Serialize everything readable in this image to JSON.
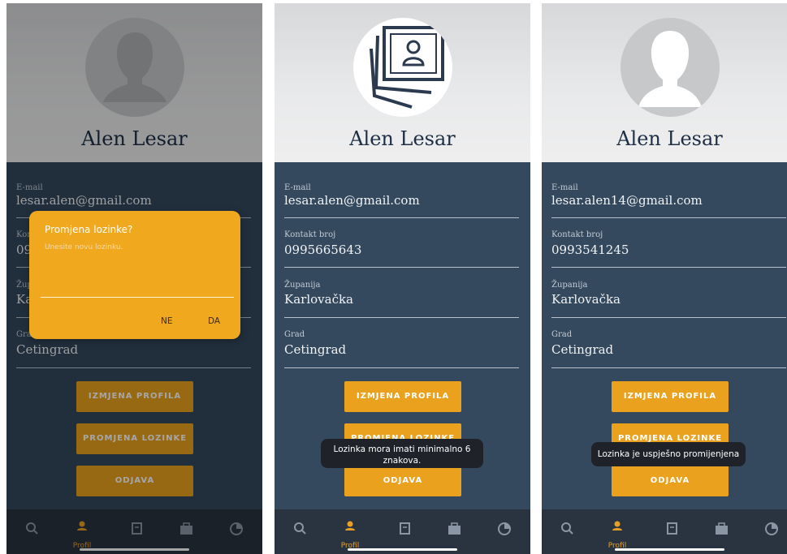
{
  "colors": {
    "accent": "#eaa21e",
    "background": "#34495e",
    "navbar": "#2a3440"
  },
  "screens": [
    {
      "name": "Alen Lesar",
      "fields": [
        {
          "label": "E-mail",
          "value": "lesar.alen@gmail.com"
        },
        {
          "label": "Kontakt broj",
          "value": "0995665643"
        },
        {
          "label": "Županija",
          "value": "Karlovačka"
        },
        {
          "label": "Grad",
          "value": "Cetingrad"
        }
      ],
      "buttons": {
        "edit": "IZMJENA PROFILA",
        "password": "PROMJENA LOZINKE",
        "logout": "ODJAVA"
      },
      "dialog": {
        "title": "Promjena lozinke?",
        "hint": "Unesite novu lozinku.",
        "no": "NE",
        "yes": "DA"
      },
      "nav": {
        "active_label": "Profil"
      }
    },
    {
      "name": "Alen Lesar",
      "fields": [
        {
          "label": "E-mail",
          "value": "lesar.alen@gmail.com"
        },
        {
          "label": "Kontakt broj",
          "value": "0995665643"
        },
        {
          "label": "Županija",
          "value": "Karlovačka"
        },
        {
          "label": "Grad",
          "value": "Cetingrad"
        }
      ],
      "buttons": {
        "edit": "IZMJENA PROFILA",
        "password": "PROMJENA LOZINKE",
        "logout": "ODJAVA"
      },
      "toast_line1": "Lozinka mora imati minimalno 6",
      "toast_line2": "znakova.",
      "nav": {
        "active_label": "Profil"
      }
    },
    {
      "name": "Alen Lesar",
      "fields": [
        {
          "label": "E-mail",
          "value": "lesar.alen14@gmail.com"
        },
        {
          "label": "Kontakt broj",
          "value": "0993541245"
        },
        {
          "label": "Županija",
          "value": "Karlovačka"
        },
        {
          "label": "Grad",
          "value": "Cetingrad"
        }
      ],
      "buttons": {
        "edit": "IZMJENA PROFILA",
        "password": "PROMJENA LOZINKE",
        "logout": "ODJAVA"
      },
      "toast": "Lozinka je uspješno promijenjena",
      "nav": {
        "active_label": "Profil"
      }
    }
  ]
}
